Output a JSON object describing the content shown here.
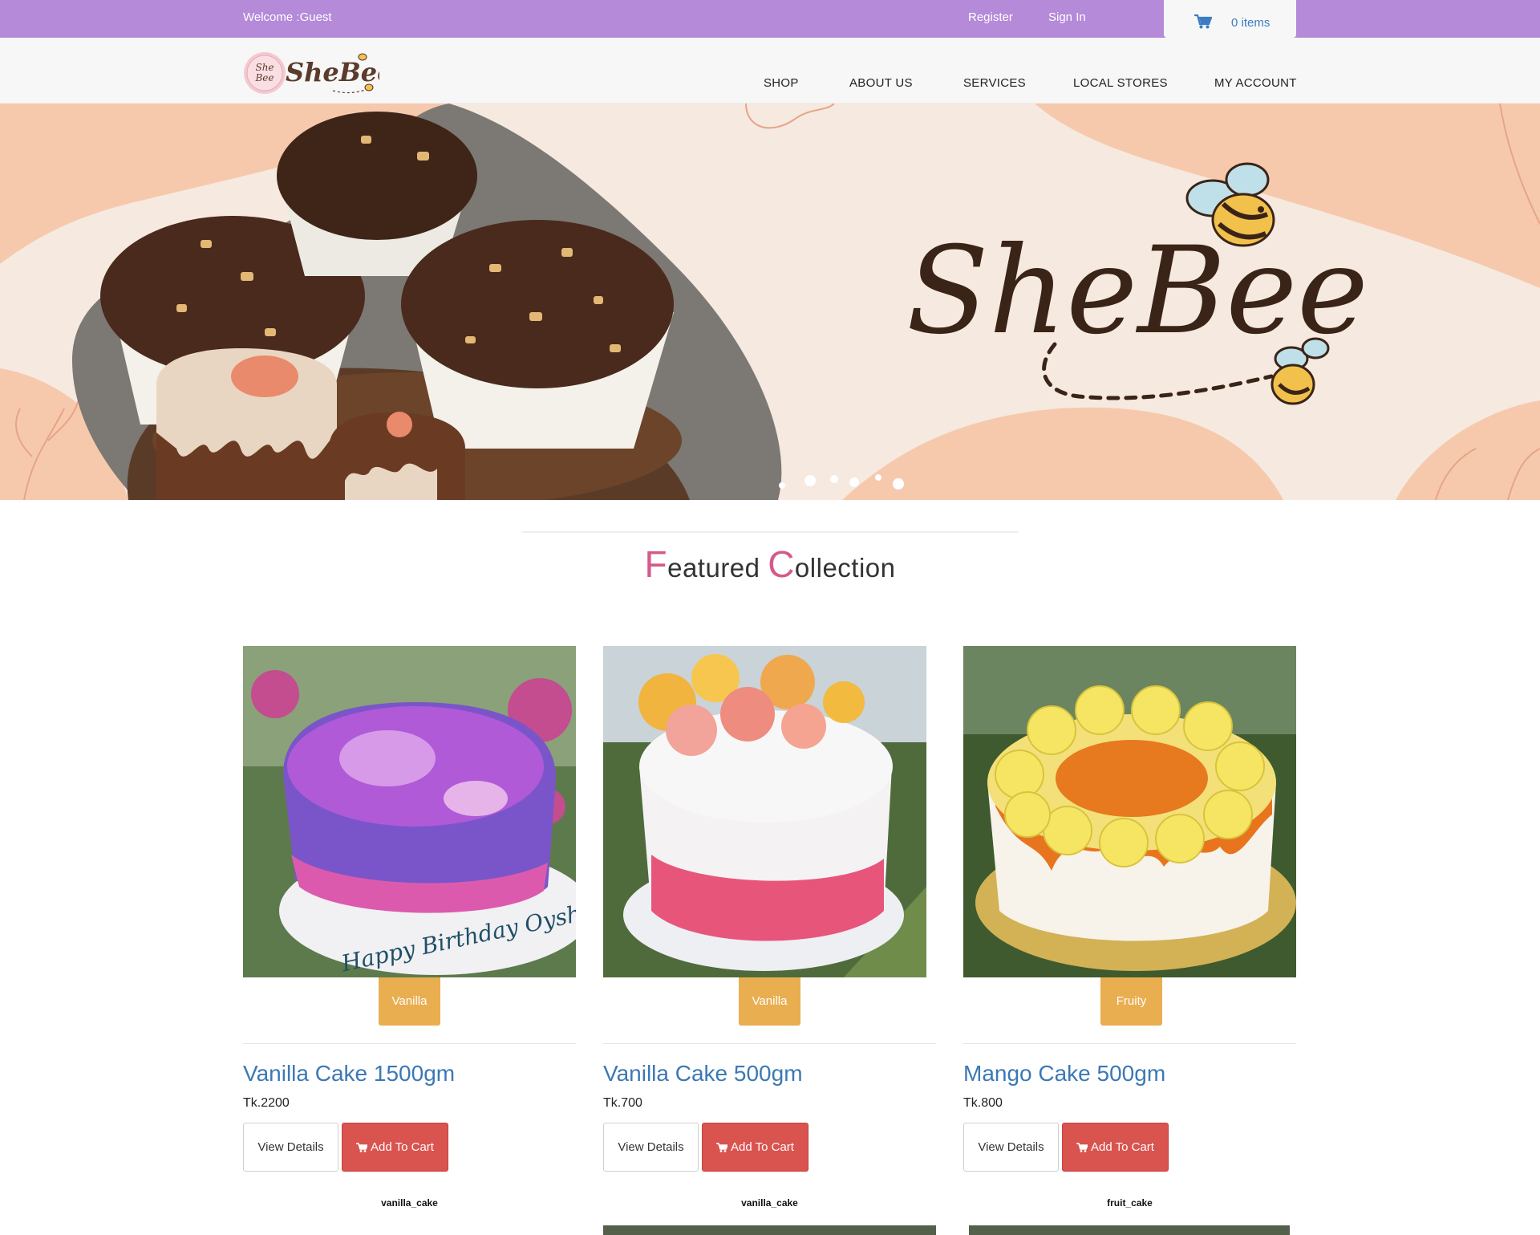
{
  "topbar": {
    "welcome": "Welcome :Guest",
    "register": "Register",
    "signin": "Sign In",
    "cart_label": "0 items"
  },
  "brand": {
    "logo_badge_line1": "She",
    "logo_badge_line2": "Bee",
    "logo_text": "SheBee",
    "hero_script": "SheBee"
  },
  "nav": {
    "items": [
      "SHOP",
      "ABOUT US",
      "SERVICES",
      "LOCAL STORES",
      "MY ACCOUNT"
    ]
  },
  "section": {
    "title_cap1": "F",
    "title_rest1": "eatured ",
    "title_cap2": "C",
    "title_rest2": "ollection"
  },
  "products": [
    {
      "tag": "Vanilla",
      "name": "Vanilla Cake 1500gm",
      "price": "Tk.2200",
      "view_label": "View Details",
      "cart_label": "Add To Cart",
      "slug": "vanilla_cake",
      "cake_inscription": "Happy Birthday Oyshi"
    },
    {
      "tag": "Vanilla",
      "name": "Vanilla Cake 500gm",
      "price": "Tk.700",
      "view_label": "View Details",
      "cart_label": "Add To Cart",
      "slug": "vanilla_cake"
    },
    {
      "tag": "Fruity",
      "name": "Mango Cake 500gm",
      "price": "Tk.800",
      "view_label": "View Details",
      "cart_label": "Add To Cart",
      "slug": "fruit_cake"
    }
  ],
  "colors": {
    "topbar": "#b48ad9",
    "link_blue": "#3c78b4",
    "tag_orange": "#e8ae50",
    "cart_red": "#d9534f",
    "title_accent": "#d55a8c",
    "hero_bg": "#f6e9df",
    "hero_peach": "#f6c9ad"
  },
  "icons": [
    "shopping-cart-icon",
    "bee-icon"
  ]
}
